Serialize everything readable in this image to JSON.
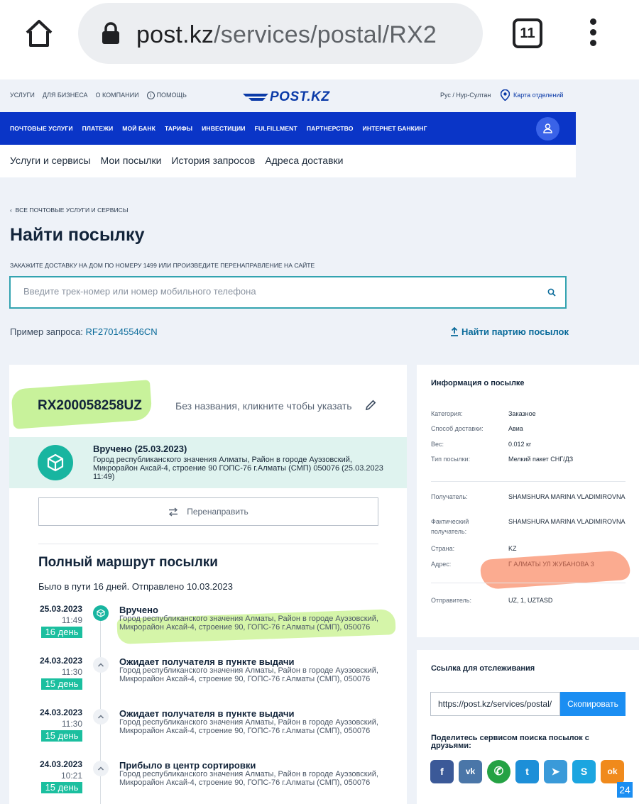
{
  "browser": {
    "url_domain": "post.kz",
    "url_path": "/services/postal/RX2",
    "tab_count": "11"
  },
  "topnav": {
    "links": [
      "УСЛУГИ",
      "ДЛЯ БИЗНЕСА",
      "О КОМПАНИИ",
      "ПОМОЩЬ"
    ],
    "logo": "POST.KZ",
    "region": "Рус / Нур-Султан",
    "branch_map": "Карта отделений"
  },
  "bluenav": {
    "items": [
      "ПОЧТОВЫЕ УСЛУГИ",
      "ПЛАТЕЖИ",
      "МОЙ БАНК",
      "ТАРИФЫ",
      "ИНВЕСТИЦИИ",
      "FULFILLMENT",
      "ПАРТНЕРСТВО",
      "ИНТЕРНЕТ БАНКИНГ"
    ]
  },
  "subnav": {
    "items": [
      "Услуги и сервисы",
      "Мои посылки",
      "История запросов",
      "Адреса доставки"
    ]
  },
  "main": {
    "breadcrumb": "ВСЕ ПОЧТОВЫЕ УСЛУГИ И СЕРВИСЫ",
    "title": "Найти посылку",
    "hint": "ЗАКАЖИТЕ ДОСТАВКУ НА ДОМ ПО НОМЕРУ 1499 ИЛИ ПРОИЗВЕДИТЕ ПЕРЕНАПРАВЛЕНИЕ НА САЙТЕ",
    "search_placeholder": "Введите трек-номер или номер мобильного телефона",
    "example_label": "Пример запроса:",
    "example_code": "RF270145546CN",
    "batch_link": "Найти партию посылок"
  },
  "parcel": {
    "track_number": "RX200058258UZ",
    "no_name": "Без названия, кликните чтобы указать",
    "status_title": "Вручено (25.03.2023)",
    "status_address": "Город республиканского значения Алматы, Район в городе Ауэзовский, Микрорайон Аксай-4, строение 90 ГОПС-76 г.Алматы (СМП) 050076 (25.03.2023 11:49)",
    "redirect_button": "Перенаправить",
    "route_title": "Полный маршрут посылки",
    "route_summary": "Было в пути 16 дней. Отправлено 10.03.2023",
    "events": [
      {
        "date": "25.03.2023",
        "time": "11:49",
        "day": "16 день",
        "name": "Вручено",
        "place": "Город республиканского значения Алматы, Район в городе Ауэзовский, Микрорайон Аксай-4, строение 90, ГОПС-76 г.Алматы (СМП), 050076"
      },
      {
        "date": "24.03.2023",
        "time": "11:30",
        "day": "15 день",
        "name": "Ожидает получателя в пункте выдачи",
        "place": "Город республиканского значения Алматы, Район в городе Ауэзовский, Микрорайон Аксай-4, строение 90, ГОПС-76 г.Алматы (СМП), 050076"
      },
      {
        "date": "24.03.2023",
        "time": "11:30",
        "day": "15 день",
        "name": "Ожидает получателя в пункте выдачи",
        "place": "Город республиканского значения Алматы, Район в городе Ауэзовский, Микрорайон Аксай-4, строение 90, ГОПС-76 г.Алматы (СМП), 050076"
      },
      {
        "date": "24.03.2023",
        "time": "10:21",
        "day": "15 день",
        "name": "Прибыло в центр сортировки",
        "place": "Город республиканского значения Алматы, Район в городе Ауэзовский, Микрорайон Аксай-4, строение 90, ГОПС-76 г.Алматы (СМП), 050076"
      }
    ]
  },
  "info": {
    "title": "Информация о посылке",
    "category_label": "Категория:",
    "category_value": "Заказное",
    "delivery_label": "Способ доставки:",
    "delivery_value": "Авиа",
    "weight_label": "Вес:",
    "weight_value": "0.012 кг",
    "type_label": "Тип посылки:",
    "type_value": "Мелкий пакет СНГ/ДЗ",
    "recipient_label": "Получатель:",
    "recipient_value": "SHAMSHURA MARINA VLADIMIROVNA",
    "actual_label": "Фактический получатель:",
    "actual_value": "SHAMSHURA MARINA VLADIMIROVNA",
    "country_label": "Страна:",
    "country_value": "KZ",
    "address_label": "Адрес:",
    "address_value": "Г АЛМАТЫ УЛ ЖУБАНОВА 3",
    "sender_label": "Отправитель:",
    "sender_value": "UZ, 1, UZTASD"
  },
  "tracking_link": {
    "title": "Ссылка для отслеживания",
    "url": "https://post.kz/services/postal/",
    "copy_button": "Скопировать",
    "share_text": "Поделитесь сервисом поиска посылок с друзьями:",
    "socials": [
      {
        "name": "facebook",
        "glyph": "f",
        "color": "#3b5998"
      },
      {
        "name": "vk",
        "glyph": "vk",
        "color": "#4a76a8"
      },
      {
        "name": "whatsapp",
        "glyph": "✆",
        "color": "#25a244"
      },
      {
        "name": "twitter",
        "glyph": "t",
        "color": "#1d8fd8"
      },
      {
        "name": "telegram",
        "glyph": "➤",
        "color": "#3a9ad9"
      },
      {
        "name": "skype",
        "glyph": "S",
        "color": "#1ba5e0"
      },
      {
        "name": "odnoklassniki",
        "glyph": "ok",
        "color": "#f08a1c"
      }
    ]
  },
  "page_badge": "24",
  "colors": {
    "brand_blue": "#0a35c7",
    "accent_teal": "#18b5a0",
    "day_green": "#1bbf9f",
    "copy_blue": "#1b8ef2"
  }
}
